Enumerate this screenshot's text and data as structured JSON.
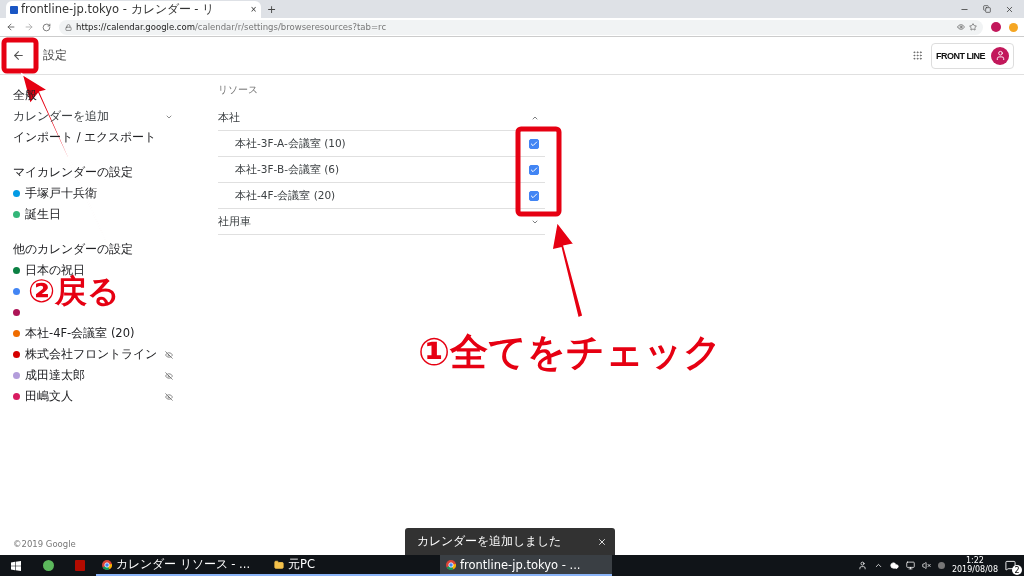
{
  "browser": {
    "tab_title": "frontline-jp.tokyo - カレンダー - リ",
    "tab_close": "×",
    "new_tab": "+",
    "url_host": "https://calendar.google.com",
    "url_path": "/calendar/r/settings/browseresources?tab=rc"
  },
  "header": {
    "title": "設定",
    "logo": "FRONT LINE"
  },
  "sidebar": [
    {
      "kind": "link",
      "text": "全般"
    },
    {
      "kind": "expandable",
      "text": "カレンダーを追加",
      "expanded": false
    },
    {
      "kind": "link",
      "text": "インポート / エクスポート"
    },
    {
      "kind": "heading",
      "text": "マイカレンダーの設定"
    },
    {
      "kind": "calendar",
      "text": "手塚戸十兵衛",
      "color": "#039be5",
      "hidden": false
    },
    {
      "kind": "calendar",
      "text": "誕生日",
      "color": "#33b679",
      "hidden": false
    },
    {
      "kind": "heading",
      "text": "他のカレンダーの設定"
    },
    {
      "kind": "calendar",
      "text": "日本の祝日",
      "color": "#0b8043",
      "hidden": false
    },
    {
      "kind": "calendar",
      "color": "#4285f4",
      "hidden": false
    },
    {
      "kind": "calendar",
      "color": "#ad1457",
      "hidden": false
    },
    {
      "kind": "calendar",
      "text": "本社-4F-会議室 (20)",
      "color": "#ef6c00",
      "hidden": false
    },
    {
      "kind": "calendar",
      "text": "株式会社フロントライン",
      "color": "#d50000",
      "hidden": true
    },
    {
      "kind": "calendar",
      "text": "成田達太郎",
      "color": "#b39ddb",
      "hidden": true
    },
    {
      "kind": "calendar",
      "text": "田嶋文人",
      "color": "#d81b60",
      "hidden": true
    }
  ],
  "resources": {
    "title": "リソース",
    "groups": [
      {
        "name": "本社",
        "expanded": true,
        "items": [
          {
            "name": "本社-3F-A-会議室 (10)",
            "checked": true
          },
          {
            "name": "本社-3F-B-会議室 (6)",
            "checked": true
          },
          {
            "name": "本社-4F-会議室 (20)",
            "checked": true
          }
        ]
      },
      {
        "name": "社用車",
        "expanded": false
      }
    ]
  },
  "footer": "©2019 Google",
  "snackbar": {
    "message": "カレンダーを追加しました"
  },
  "taskbar": {
    "apps": [
      {
        "kind": "chrome",
        "label": "カレンダー リソース - ...",
        "selected": false
      },
      {
        "kind": "folder",
        "label": "元PC",
        "selected": false
      },
      {
        "kind": "chrome",
        "label": "frontline-jp.tokyo - ...",
        "selected": true
      }
    ],
    "time": "1:22",
    "date": "2019/08/08",
    "notifications": "2"
  },
  "annotations": [
    {
      "kind": "back",
      "text": "②戻る"
    },
    {
      "kind": "check",
      "text": "①全てをチェック"
    }
  ]
}
